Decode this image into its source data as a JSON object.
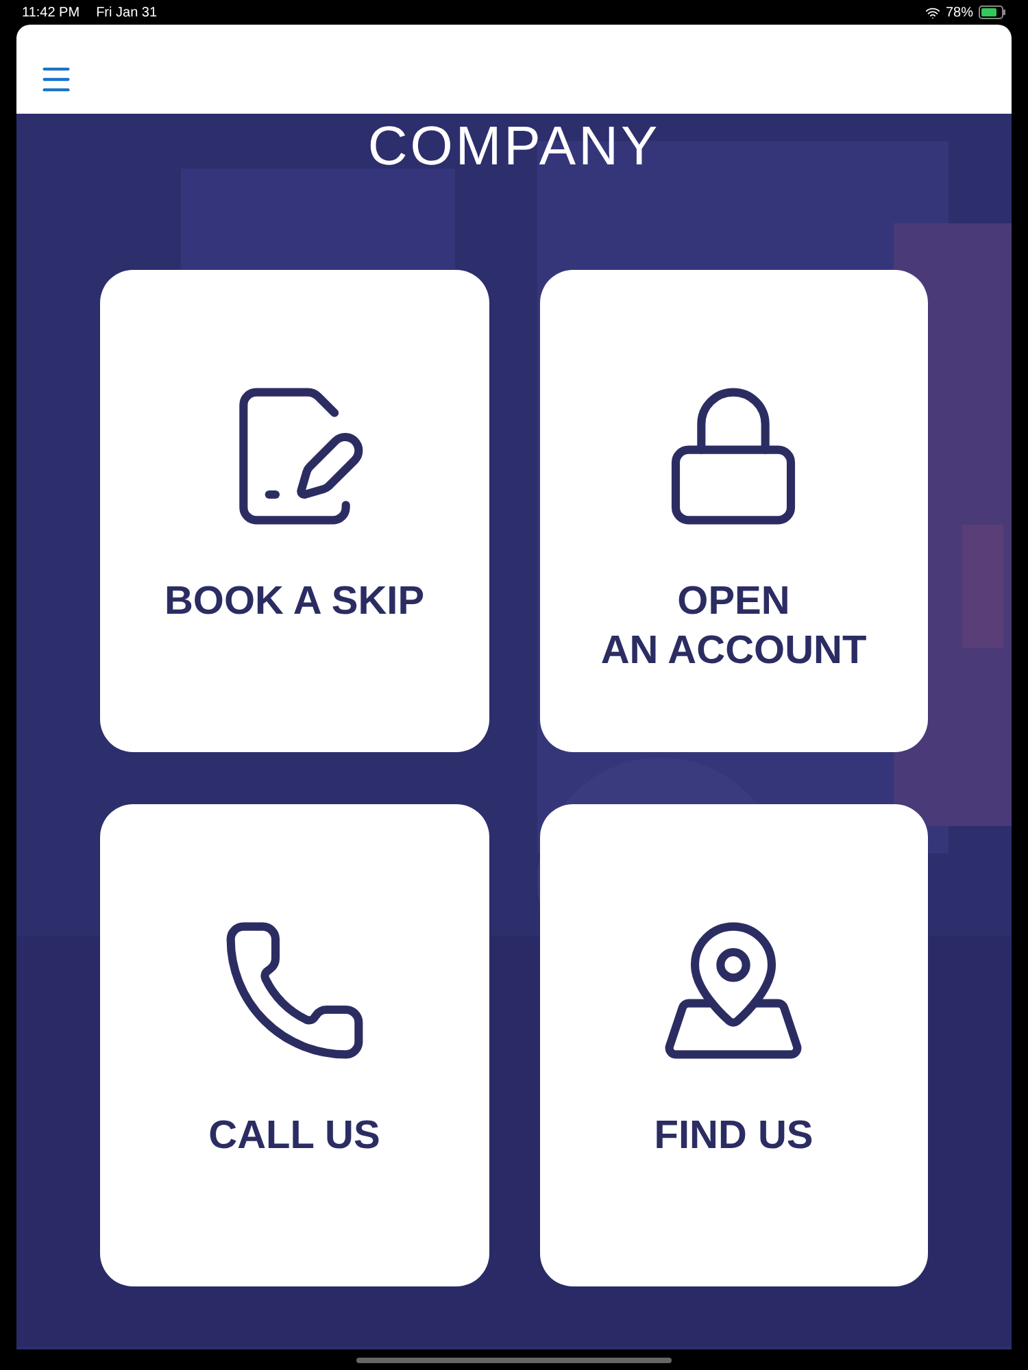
{
  "status_bar": {
    "time": "11:42 PM",
    "date": "Fri Jan 31",
    "battery": "78%"
  },
  "banner_text": "COMPANY",
  "tiles": [
    {
      "kind": "book",
      "lines": [
        "BOOK A SKIP"
      ]
    },
    {
      "kind": "account",
      "lines": [
        "OPEN",
        "AN ACCOUNT"
      ]
    },
    {
      "kind": "call",
      "lines": [
        "CALL US"
      ]
    },
    {
      "kind": "find",
      "lines": [
        "FIND US"
      ]
    }
  ]
}
